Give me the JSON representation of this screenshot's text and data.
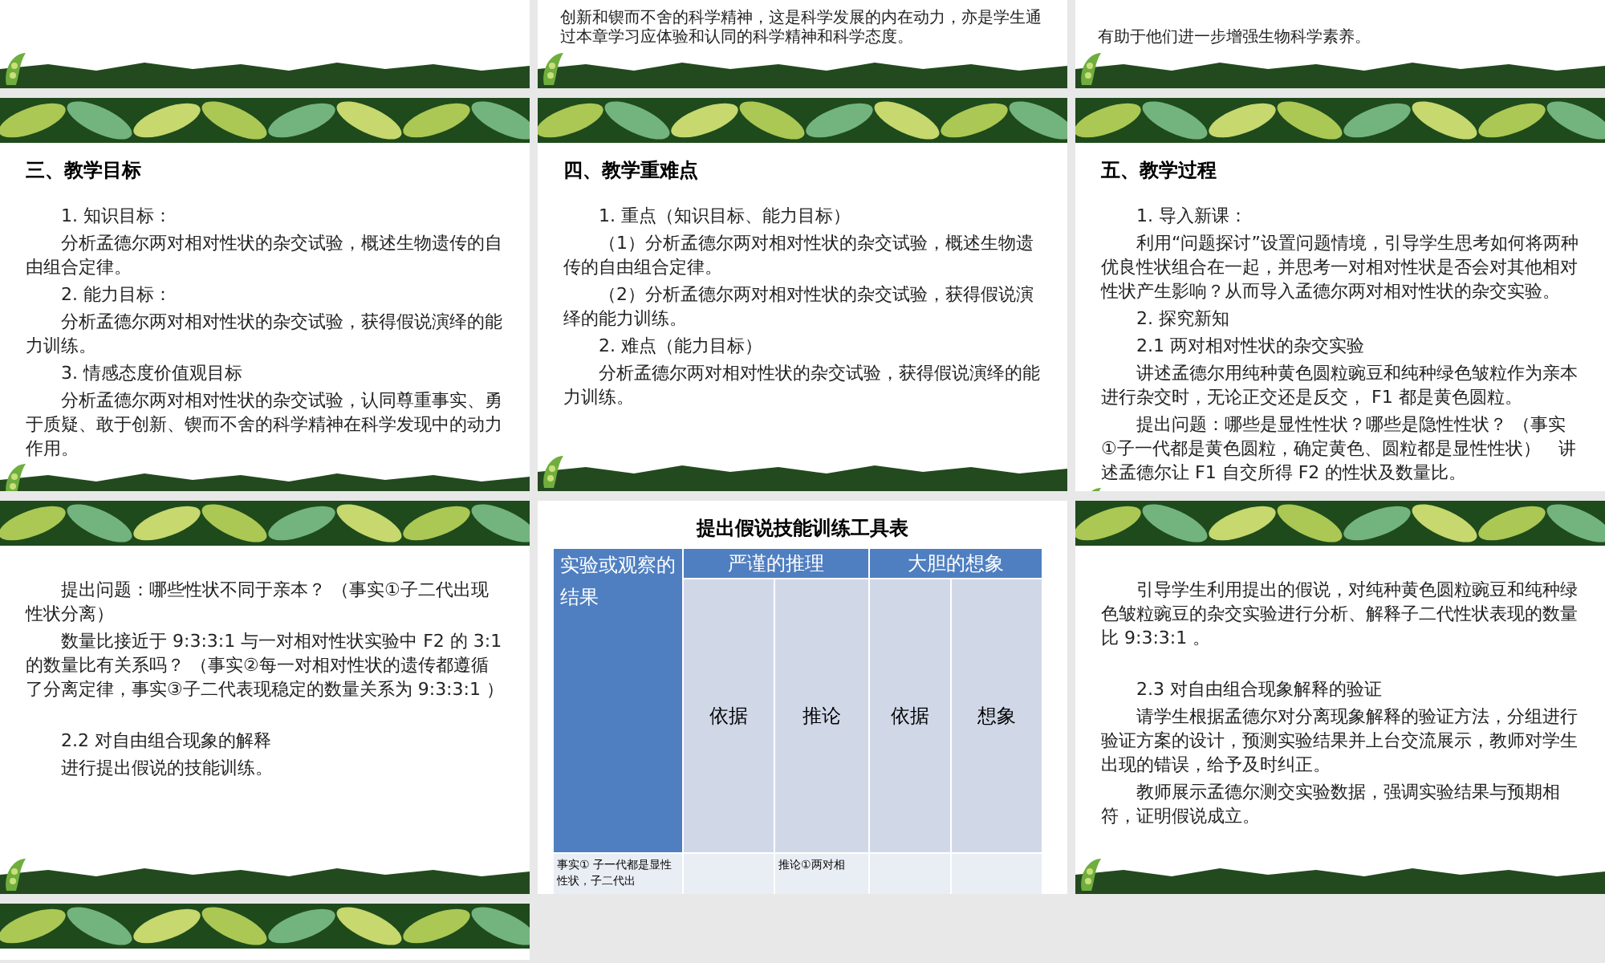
{
  "slides": [
    {
      "kind": "fragment"
    },
    {
      "kind": "fragment",
      "paragraphs": [
        "创新和锲而不舍的科学精神，这是科学发展的内在动力，亦是学生通过本章学习应体验和认同的科学精神和科学态度。"
      ]
    },
    {
      "kind": "fragment",
      "paragraphs": [
        "有助于他们进一步增强生物科学素养。"
      ]
    },
    {
      "kind": "text",
      "title": "三、教学目标",
      "paragraphs": [
        "1. 知识目标：",
        "分析孟德尔两对相对性状的杂交试验，概述生物遗传的自由组合定律。",
        "2. 能力目标：",
        "分析孟德尔两对相对性状的杂交试验，获得假说演绎的能力训练。",
        "3. 情感态度价值观目标",
        "分析孟德尔两对相对性状的杂交试验，认同尊重事实、勇于质疑、敢于创新、锲而不舍的科学精神在科学发现中的动力作用。"
      ]
    },
    {
      "kind": "text",
      "title": "四、教学重难点",
      "paragraphs": [
        "1. 重点（知识目标、能力目标）",
        "（1）分析孟德尔两对相对性状的杂交试验，概述生物遗传的自由组合定律。",
        "（2）分析孟德尔两对相对性状的杂交试验，获得假说演绎的能力训练。",
        "2. 难点（能力目标）",
        "分析孟德尔两对相对性状的杂交试验，获得假说演绎的能力训练。"
      ]
    },
    {
      "kind": "text",
      "title": "五、教学过程",
      "paragraphs": [
        "1. 导入新课：",
        "利用“问题探讨”设置问题情境，引导学生思考如何将两种优良性状组合在一起，并思考一对相对性状是否会对其他相对性状产生影响？从而导入孟德尔两对相对性状的杂交实验。",
        "2. 探究新知",
        "2.1 两对相对性状的杂交实验",
        "讲述孟德尔用纯种黄色圆粒豌豆和纯种绿色皱粒作为亲本进行杂交时，无论正交还是反交， F1 都是黄色圆粒。",
        "提出问题：哪些是显性性状？哪些是隐性性状？ （事实①子一代都是黄色圆粒，确定黄色、圆粒都是显性性状）　讲述孟德尔让 F1 自交所得 F2 的性状及数量比。"
      ]
    },
    {
      "kind": "text",
      "paragraphs": [
        "提出问题：哪些性状不同于亲本？ （事实①子二代出现性状分离）",
        "数量比接近于 9:3:3:1 与一对相对性状实验中 F2 的 3:1 的数量比有关系吗？ （事实②每一对相对性状的遗传都遵循了分离定律，事实③子二代表现稳定的数量关系为 9:3:3:1 ）",
        {
          "text": "2.2 对自由组合现象的解释",
          "spaced": true
        },
        "进行提出假说的技能训练。"
      ]
    },
    {
      "kind": "table",
      "title": "提出假说技能训练工具表",
      "corner": "实验或观察的结果",
      "groups": [
        "严谨的推理",
        "大胆的想象"
      ],
      "columns": [
        "依据",
        "推论",
        "依据",
        "想象"
      ],
      "row": {
        "column_1": "事实① 子一代都是显性性状，子二代出",
        "column_3": "推论①两对相"
      }
    },
    {
      "kind": "text",
      "paragraphs": [
        "引导学生利用提出的假说，对纯种黄色圆粒豌豆和纯种绿色皱粒豌豆的杂交实验进行分析、解释子二代性状表现的数量比 9:3:3:1 。",
        {
          "text": "2.3 对自由组合现象解释的验证",
          "spaced": true
        },
        "请学生根据孟德尔对分离现象解释的验证方法，分组进行验证方案的设计，预测实验结果并上台交流展示，教师对学生出现的错误，给予及时纠正。",
        "教师展示孟德尔测交实验数据，强调实验结果与预期相符，证明假说成立。"
      ]
    },
    {
      "kind": "banner"
    }
  ]
}
